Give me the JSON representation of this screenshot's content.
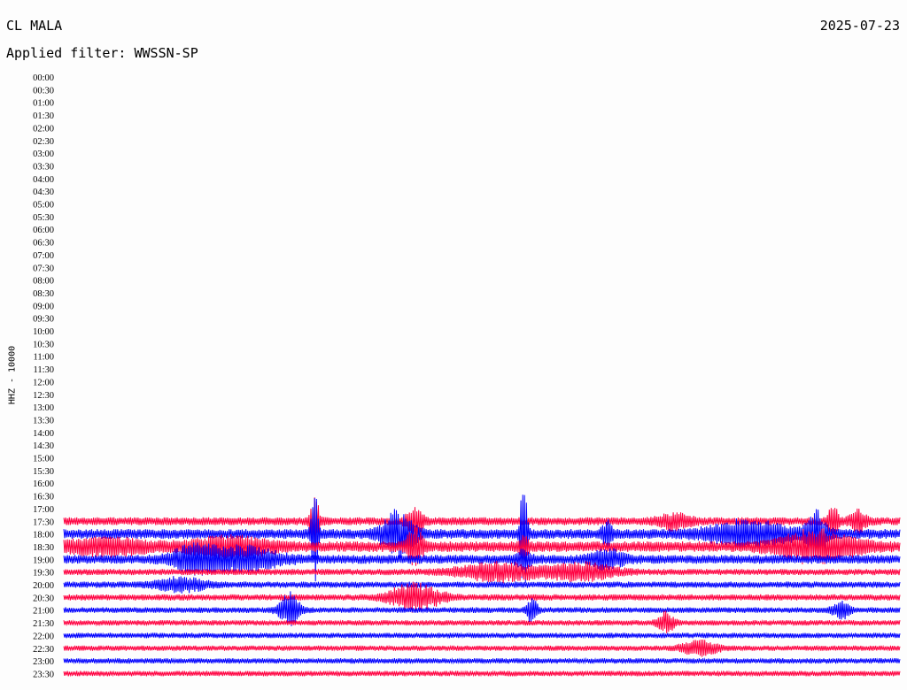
{
  "header": {
    "station": "CL MALA",
    "date": "2025-07-23",
    "filter_text": "Applied filter: WWSSN-SP",
    "channel_label": "HHZ - 10000"
  },
  "chart_data": {
    "type": "line",
    "title": "CL MALA",
    "subtitle": "Applied filter: WWSSN-SP",
    "ylabel": "HHZ - 10000",
    "xlabel": "",
    "row_labels": [
      "00:00",
      "00:30",
      "01:00",
      "01:30",
      "02:00",
      "02:30",
      "03:00",
      "03:30",
      "04:00",
      "04:30",
      "05:00",
      "05:30",
      "06:00",
      "06:30",
      "07:00",
      "07:30",
      "08:00",
      "08:30",
      "09:00",
      "09:30",
      "10:00",
      "10:30",
      "11:00",
      "11:30",
      "12:00",
      "12:30",
      "13:00",
      "13:30",
      "14:00",
      "14:30",
      "15:00",
      "15:30",
      "16:00",
      "16:30",
      "17:00",
      "17:30",
      "18:00",
      "18:30",
      "19:00",
      "19:30",
      "20:00",
      "20:30",
      "21:00",
      "21:30",
      "22:00",
      "22:30",
      "23:00",
      "23:30"
    ],
    "trace_colors": [
      "#ff0040",
      "#0000ff"
    ],
    "traces_start_row": 35,
    "traces": [
      {
        "row": "17:30",
        "noise": 4.5,
        "events": [
          {
            "x": 0.3,
            "amp": 26,
            "w": 0.006
          },
          {
            "x": 0.42,
            "amp": 16,
            "w": 0.01
          },
          {
            "x": 0.73,
            "amp": 8,
            "w": 0.02
          },
          {
            "x": 0.92,
            "amp": 20,
            "w": 0.006
          },
          {
            "x": 0.95,
            "amp": 12,
            "w": 0.01
          }
        ]
      },
      {
        "row": "18:00",
        "noise": 5.5,
        "events": [
          {
            "x": 0.3,
            "amp": 55,
            "w": 0.004
          },
          {
            "x": 0.4,
            "amp": 24,
            "w": 0.02
          },
          {
            "x": 0.55,
            "amp": 70,
            "w": 0.004
          },
          {
            "x": 0.65,
            "amp": 14,
            "w": 0.006
          },
          {
            "x": 0.82,
            "amp": 14,
            "w": 0.05
          },
          {
            "x": 0.9,
            "amp": 24,
            "w": 0.012
          }
        ]
      },
      {
        "row": "18:30",
        "noise": 6,
        "events": [
          {
            "x": 0.05,
            "amp": 8,
            "w": 0.05
          },
          {
            "x": 0.2,
            "amp": 10,
            "w": 0.05
          },
          {
            "x": 0.42,
            "amp": 18,
            "w": 0.01
          },
          {
            "x": 0.55,
            "amp": 12,
            "w": 0.006
          },
          {
            "x": 0.9,
            "amp": 16,
            "w": 0.05
          }
        ]
      },
      {
        "row": "19:00",
        "noise": 5,
        "events": [
          {
            "x": 0.16,
            "amp": 16,
            "w": 0.03
          },
          {
            "x": 0.22,
            "amp": 12,
            "w": 0.04
          },
          {
            "x": 0.55,
            "amp": 10,
            "w": 0.01
          },
          {
            "x": 0.65,
            "amp": 10,
            "w": 0.02
          }
        ]
      },
      {
        "row": "19:30",
        "noise": 3.5,
        "events": [
          {
            "x": 0.52,
            "amp": 10,
            "w": 0.05
          },
          {
            "x": 0.62,
            "amp": 10,
            "w": 0.04
          }
        ]
      },
      {
        "row": "20:00",
        "noise": 3.5,
        "events": [
          {
            "x": 0.14,
            "amp": 8,
            "w": 0.03
          }
        ]
      },
      {
        "row": "20:30",
        "noise": 3.5,
        "events": [
          {
            "x": 0.42,
            "amp": 16,
            "w": 0.03
          }
        ]
      },
      {
        "row": "21:00",
        "noise": 3.2,
        "events": [
          {
            "x": 0.27,
            "amp": 20,
            "w": 0.012
          },
          {
            "x": 0.56,
            "amp": 16,
            "w": 0.006
          },
          {
            "x": 0.93,
            "amp": 10,
            "w": 0.01
          }
        ]
      },
      {
        "row": "21:30",
        "noise": 3,
        "events": [
          {
            "x": 0.72,
            "amp": 12,
            "w": 0.01
          }
        ]
      },
      {
        "row": "22:00",
        "noise": 3,
        "events": []
      },
      {
        "row": "22:30",
        "noise": 3,
        "events": [
          {
            "x": 0.76,
            "amp": 10,
            "w": 0.02
          }
        ]
      },
      {
        "row": "23:00",
        "noise": 3,
        "events": []
      },
      {
        "row": "23:30",
        "noise": 3,
        "events": []
      }
    ]
  }
}
